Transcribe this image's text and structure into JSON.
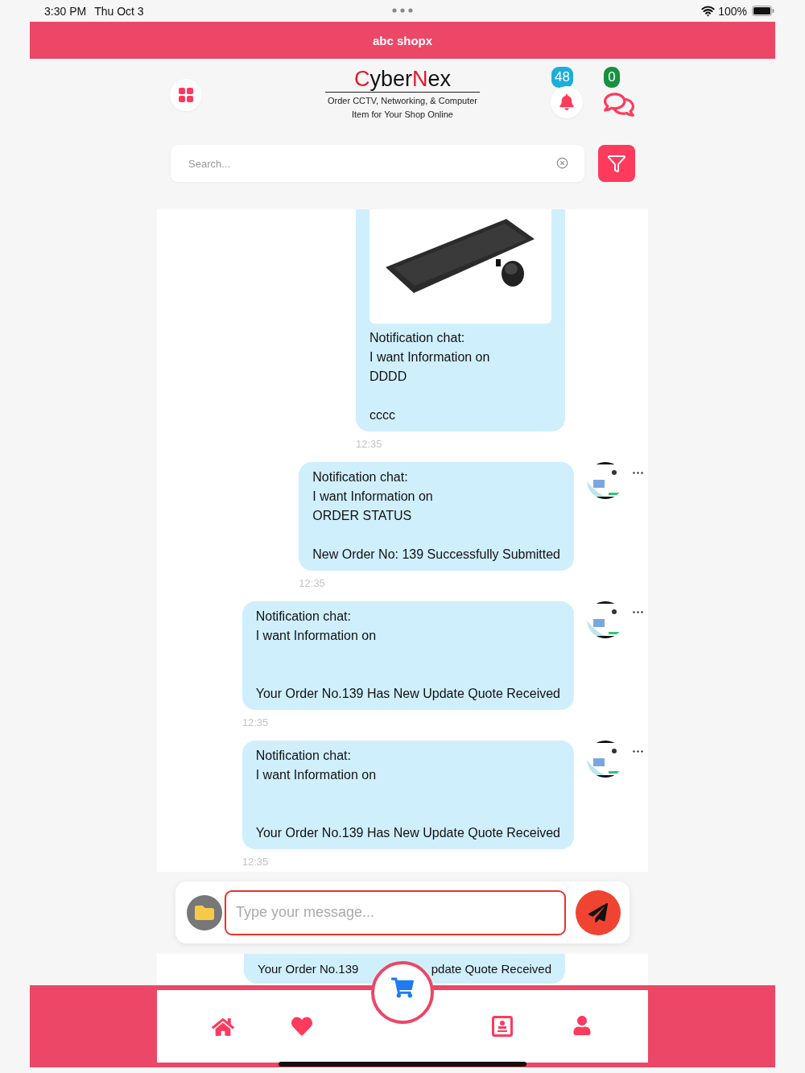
{
  "status_bar": {
    "time": "3:30 PM",
    "date": "Thu Oct 3",
    "battery": "100%"
  },
  "app_bar": {
    "title": "abc shopx"
  },
  "brand": {
    "logo": [
      {
        "text": "C",
        "accent": true
      },
      {
        "text": "yber",
        "accent": false
      },
      {
        "text": "N",
        "accent": true
      },
      {
        "text": "ex",
        "accent": false
      }
    ],
    "tagline": [
      "Order CCTV, Networking, & Computer",
      "Item for Your Shop Online"
    ]
  },
  "notifications": {
    "count": "48"
  },
  "messages_badge": {
    "count": "0"
  },
  "search": {
    "placeholder": "Search..."
  },
  "chat": [
    {
      "avatar": false,
      "heading": "Notification chat:",
      "intro": "I want Information on",
      "subject": "DDDD",
      "detail": "cccc",
      "time": "12:35"
    },
    {
      "avatar": true,
      "heading": "Notification chat:",
      "intro": "I want Information on",
      "subject": "ORDER STATUS",
      "detail": "New Order No: 139 Successfully Submitted",
      "time": "12:35"
    },
    {
      "avatar": true,
      "heading": "Notification chat:",
      "intro": "I want Information on",
      "detail": "Your Order No.139 Has New Update Quote Received",
      "time": "12:35"
    },
    {
      "avatar": true,
      "heading": "Notification chat:",
      "intro": "I want Information on",
      "detail": "Your Order No.139 Has New Update Quote Received",
      "time": "12:35"
    }
  ],
  "composer": {
    "placeholder": "Type your message..."
  },
  "partial_message": {
    "parts": [
      "Your Order No.139",
      "pdate Quote Received"
    ]
  }
}
